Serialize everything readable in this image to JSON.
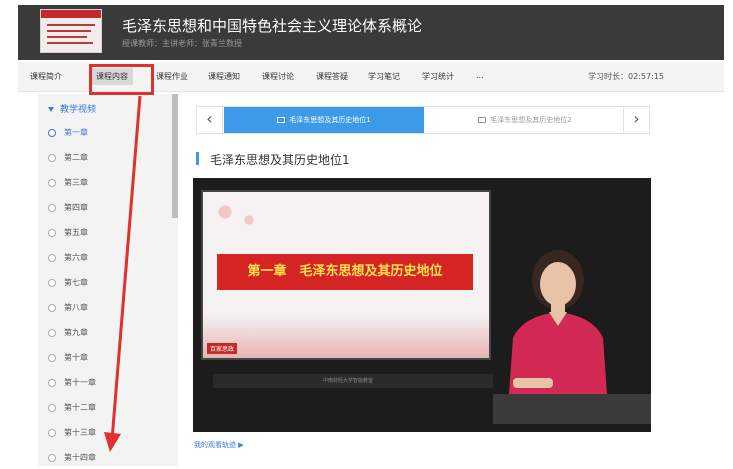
{
  "header": {
    "course_title": "毛泽东思想和中国特色社会主义理论体系概论",
    "course_sub": "授课教师：主讲老师：张青兰数授"
  },
  "nav": {
    "items": [
      "课程简介",
      "课程内容",
      "课程作业",
      "课程通知",
      "课程讨论",
      "课程答疑",
      "学习笔记",
      "学习统计",
      "..."
    ],
    "active_index": 1,
    "study_time": "学习时长：02:57:15"
  },
  "sidebar": {
    "section_title": "教学视频",
    "chapters": [
      "第一章",
      "第二章",
      "第三章",
      "第四章",
      "第五章",
      "第六章",
      "第七章",
      "第八章",
      "第九章",
      "第十章",
      "第十一章",
      "第十二章",
      "第十三章",
      "第十四章"
    ]
  },
  "lessons": {
    "prev_icon": "‹",
    "next_icon": "›",
    "tabs": [
      "毛泽东思想及其历史地位1",
      "毛泽东思想及其历史地位2"
    ]
  },
  "lesson_title": "毛泽东思想及其历史地位1",
  "video": {
    "slide_text": "第一章　毛泽东思想及其历史地位",
    "logo_text": "百家思政",
    "brand_text": "中南财经大学智能教室"
  },
  "footer_link": "我的观看轨迹 ▶",
  "colors": {
    "accent": "#3d9ae8",
    "annotation": "#e0312f",
    "header_bg": "#3a3a3a"
  }
}
